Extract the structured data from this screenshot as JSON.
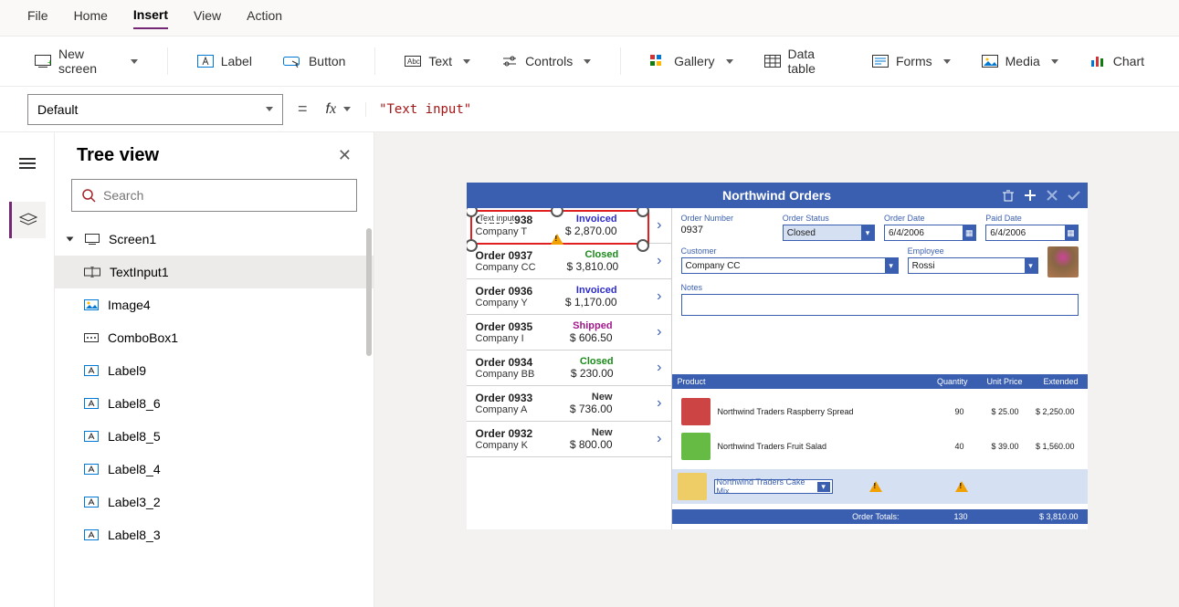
{
  "menu": {
    "items": [
      "File",
      "Home",
      "Insert",
      "View",
      "Action"
    ],
    "active": "Insert"
  },
  "ribbon": {
    "new_screen": "New screen",
    "label": "Label",
    "button": "Button",
    "text": "Text",
    "controls": "Controls",
    "gallery": "Gallery",
    "datatable": "Data table",
    "forms": "Forms",
    "media": "Media",
    "chart": "Chart"
  },
  "formula": {
    "property": "Default",
    "value": "\"Text input\""
  },
  "tree": {
    "title": "Tree view",
    "search_placeholder": "Search",
    "screen": "Screen1",
    "items": [
      "TextInput1",
      "Image4",
      "ComboBox1",
      "Label9",
      "Label8_6",
      "Label8_5",
      "Label8_4",
      "Label3_2",
      "Label8_3"
    ],
    "selected": "TextInput1"
  },
  "app": {
    "title": "Northwind Orders",
    "selection_placeholder": "Text input",
    "orders": [
      {
        "title": "Order 0938",
        "company": "Company T",
        "status": "Invoiced",
        "status_class": "invoiced",
        "price": "$ 2,870.00"
      },
      {
        "title": "Order 0937",
        "company": "Company CC",
        "status": "Closed",
        "status_class": "closed",
        "price": "$ 3,810.00"
      },
      {
        "title": "Order 0936",
        "company": "Company Y",
        "status": "Invoiced",
        "status_class": "invoiced",
        "price": "$ 1,170.00"
      },
      {
        "title": "Order 0935",
        "company": "Company I",
        "status": "Shipped",
        "status_class": "shipped",
        "price": "$ 606.50"
      },
      {
        "title": "Order 0934",
        "company": "Company BB",
        "status": "Closed",
        "status_class": "closed",
        "price": "$ 230.00"
      },
      {
        "title": "Order 0933",
        "company": "Company A",
        "status": "New",
        "status_class": "new",
        "price": "$ 736.00"
      },
      {
        "title": "Order 0932",
        "company": "Company K",
        "status": "New",
        "status_class": "new",
        "price": "$ 800.00"
      }
    ],
    "form": {
      "labels": {
        "order_number": "Order Number",
        "order_status": "Order Status",
        "order_date": "Order Date",
        "paid_date": "Paid Date",
        "customer": "Customer",
        "employee": "Employee",
        "notes": "Notes"
      },
      "order_number": "0937",
      "order_status": "Closed",
      "order_date": "6/4/2006",
      "paid_date": "6/4/2006",
      "customer": "Company CC",
      "employee": "Rossi"
    },
    "table": {
      "headers": [
        "Product",
        "Quantity",
        "Unit Price",
        "Extended"
      ],
      "rows": [
        {
          "name": "Northwind Traders Raspberry Spread",
          "qty": "90",
          "unit": "$ 25.00",
          "ext": "$ 2,250.00",
          "color": "red"
        },
        {
          "name": "Northwind Traders Fruit Salad",
          "qty": "40",
          "unit": "$ 39.00",
          "ext": "$ 1,560.00",
          "color": "green"
        }
      ],
      "new_product": "Northwind Traders Cake Mix",
      "totals_label": "Order Totals:",
      "totals_qty": "130",
      "totals_ext": "$ 3,810.00"
    }
  }
}
